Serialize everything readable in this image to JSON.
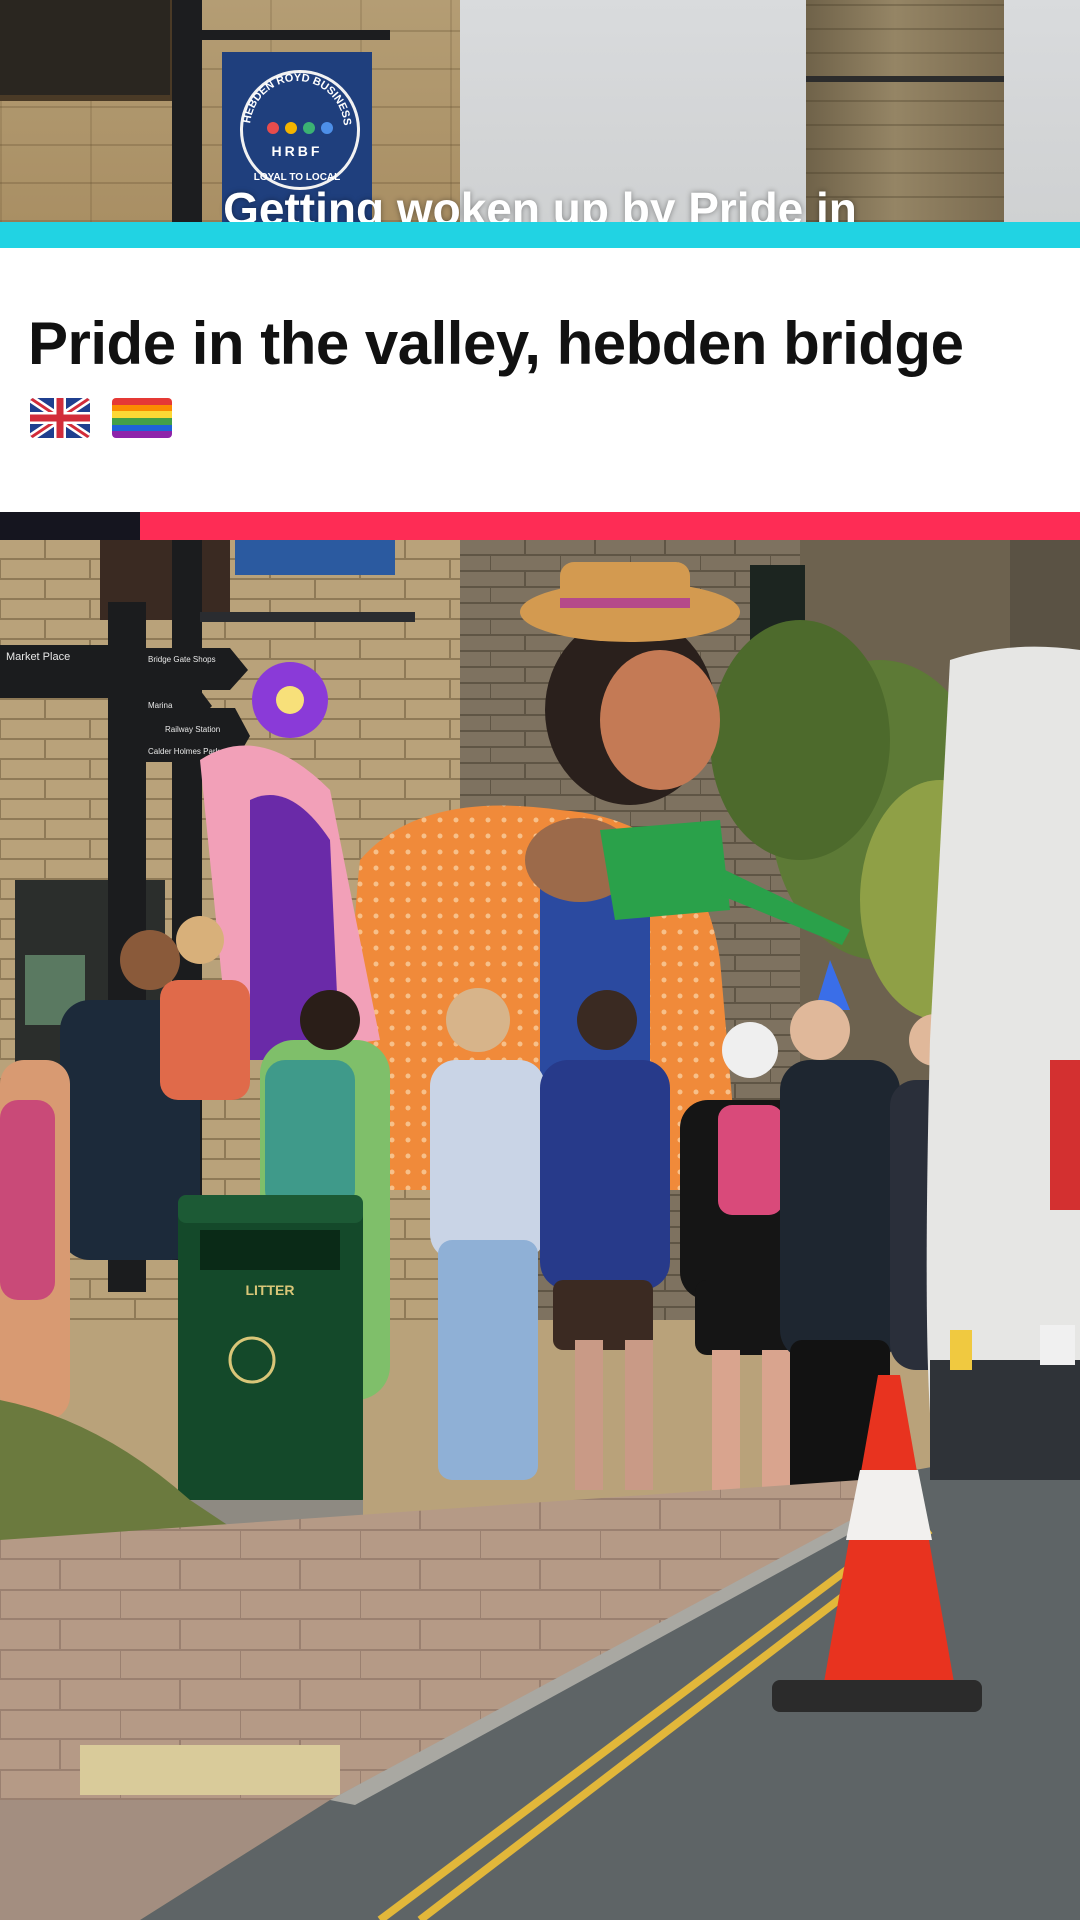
{
  "overlay": {
    "caption_partial": "Getting woken up by Pride in"
  },
  "card": {
    "title": "Pride in the valley, hebden bridge",
    "emojis": [
      "uk-flag-icon",
      "rainbow-flag-icon"
    ]
  },
  "scene": {
    "banner_text_top": "HEBDEN ROYD BUSINESS FORUM",
    "banner_letters": "HRBF",
    "banner_text_bottom": "LOYAL TO LOCAL",
    "sign_market_place": "Market Place",
    "sign_bridge_gate": "Bridge Gate Shops",
    "sign_marina": "Marina",
    "sign_railway": "Railway Station",
    "sign_calder": "Calder Holmes Park",
    "bin_label": "LITTER"
  },
  "colors": {
    "accent_cyan": "#21d3e3",
    "accent_red": "#fe2c55",
    "card_bg": "#ffffff",
    "title_text": "#111111"
  }
}
